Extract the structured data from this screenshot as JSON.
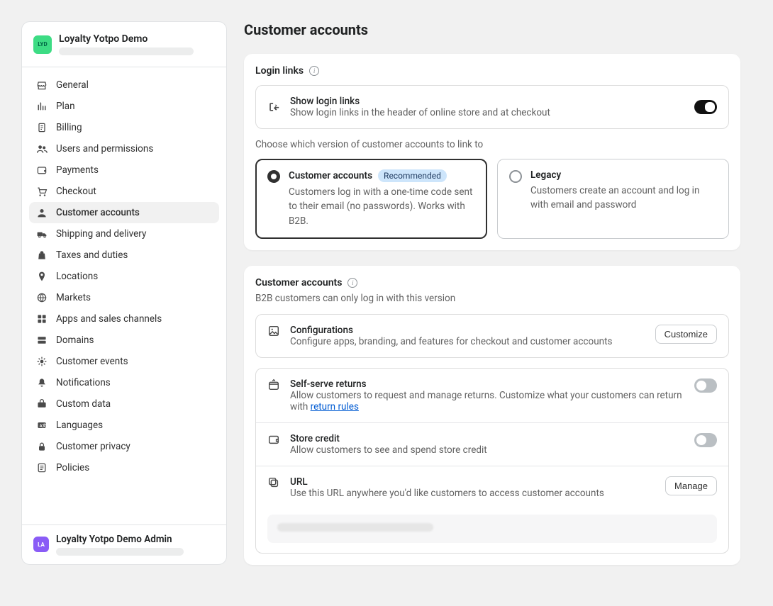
{
  "sidebar": {
    "app_logo_text": "LYD",
    "app_title": "Loyalty Yotpo Demo",
    "items": [
      {
        "icon": "store-icon",
        "label": "General"
      },
      {
        "icon": "chart-icon",
        "label": "Plan"
      },
      {
        "icon": "receipt-icon",
        "label": "Billing"
      },
      {
        "icon": "users-icon",
        "label": "Users and permissions"
      },
      {
        "icon": "wallet-icon",
        "label": "Payments"
      },
      {
        "icon": "cart-icon",
        "label": "Checkout"
      },
      {
        "icon": "person-icon",
        "label": "Customer accounts",
        "active": true
      },
      {
        "icon": "truck-icon",
        "label": "Shipping and delivery"
      },
      {
        "icon": "bag-icon",
        "label": "Taxes and duties"
      },
      {
        "icon": "pin-icon",
        "label": "Locations"
      },
      {
        "icon": "globe-icon",
        "label": "Markets"
      },
      {
        "icon": "grid-icon",
        "label": "Apps and sales channels"
      },
      {
        "icon": "domains-icon",
        "label": "Domains"
      },
      {
        "icon": "events-icon",
        "label": "Customer events"
      },
      {
        "icon": "bell-icon",
        "label": "Notifications"
      },
      {
        "icon": "data-icon",
        "label": "Custom data"
      },
      {
        "icon": "language-icon",
        "label": "Languages"
      },
      {
        "icon": "lock-icon",
        "label": "Customer privacy"
      },
      {
        "icon": "policies-icon",
        "label": "Policies"
      }
    ],
    "admin_logo_text": "LA",
    "admin_title": "Loyalty Yotpo Demo Admin"
  },
  "page": {
    "title": "Customer accounts"
  },
  "login_links_card": {
    "title": "Login links",
    "row_label": "Show login links",
    "row_desc": "Show login links in the header of online store and at checkout",
    "toggle_on": true,
    "hint": "Choose which version of customer accounts to link to",
    "options": [
      {
        "title": "Customer accounts",
        "badge": "Recommended",
        "desc": "Customers log in with a one-time code sent to their email (no passwords). Works with B2B.",
        "selected": true
      },
      {
        "title": "Legacy",
        "desc": "Customers create an account and log in with email and password",
        "selected": false
      }
    ]
  },
  "accounts_card": {
    "title": "Customer accounts",
    "subtitle": "B2B customers can only log in with this version",
    "config_row": {
      "label": "Configurations",
      "desc": "Configure apps, branding, and features for checkout and customer accounts",
      "button": "Customize"
    },
    "features": [
      {
        "label": "Self-serve returns",
        "desc_before": "Allow customers to request and manage returns. Customize what your customers can return with ",
        "link_text": "return rules",
        "toggle": false
      },
      {
        "label": "Store credit",
        "desc": "Allow customers to see and spend store credit",
        "toggle": false
      }
    ],
    "url_row": {
      "label": "URL",
      "desc": "Use this URL anywhere you'd like customers to access customer accounts",
      "button": "Manage"
    }
  }
}
